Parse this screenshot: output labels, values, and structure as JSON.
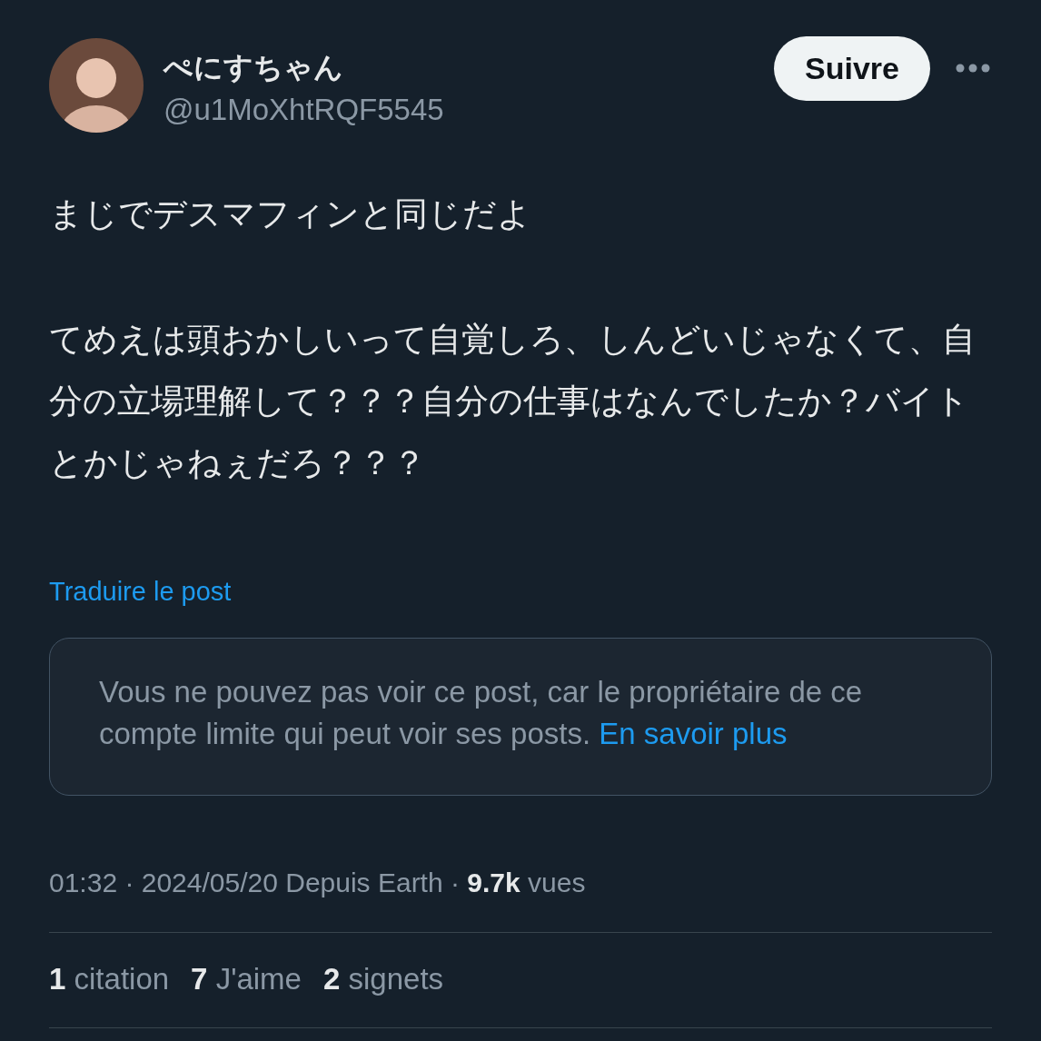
{
  "author": {
    "name": "ぺにすちゃん",
    "handle": "@u1MoXhtRQF5545"
  },
  "follow_button": "Suivre",
  "post": {
    "paragraphs": [
      "まじでデスマフィンと同じだよ",
      "てめえは頭おかしいって自覚しろ、しんどいじゃなくて、自分の立場理解して？？？自分の仕事はなんでしたか？バイトとかじゃねぇだろ？？？"
    ]
  },
  "translate_link": "Traduire le post",
  "notice": {
    "text": "Vous ne pouvez pas voir ce post, car le propriétaire de ce compte limite qui peut voir ses posts.",
    "link": "En savoir plus"
  },
  "meta": "01:32 · 2024/05/20 Depuis Earth · **9.7k** vues",
  "stats": [
    {
      "count": "1",
      "label": "citation"
    },
    {
      "count": "7",
      "label": "J'aime"
    },
    {
      "count": "2",
      "label": "signets"
    }
  ]
}
